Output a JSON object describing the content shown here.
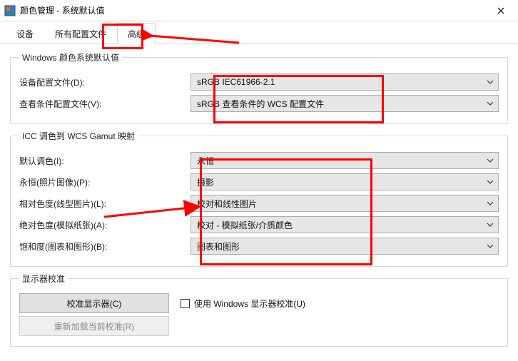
{
  "window": {
    "title": "颜色管理 - 系统默认值"
  },
  "tabs": {
    "device": "设备",
    "allProfiles": "所有配置文件",
    "advanced": "高级"
  },
  "group1": {
    "legend": "Windows 颜色系统默认值",
    "deviceProfileLabel": "设备配置文件(D):",
    "deviceProfileValue": "sRGB IEC61966-2.1",
    "viewingCondProfileLabel": "查看条件配置文件(V):",
    "viewingCondProfileValue": "sRGB 查看条件的 WCS 配置文件"
  },
  "group2": {
    "legend": "ICC 调色到 WCS Gamut 映射",
    "defaultRenderingLabel": "默认调色(I):",
    "defaultRenderingValue": "永恒",
    "perceptualLabel": "永恒(照片图像)(P):",
    "perceptualValue": "摄影",
    "relColLabel": "相对色度(线型图片)(L):",
    "relColValue": "校对和线性图片",
    "absColLabel": "绝对色度(模拟纸张)(A):",
    "absColValue": "校对 - 模拟纸张/介质颜色",
    "saturationLabel": "饱和度(图表和图形)(B):",
    "saturationValue": "图表和图形"
  },
  "group3": {
    "legend": "显示器校准",
    "calibrateBtn": "校准显示器(C)",
    "useWinCalib": "使用 Windows 显示器校准(U)",
    "reloadBtn": "重新加载当前校准(R)"
  }
}
